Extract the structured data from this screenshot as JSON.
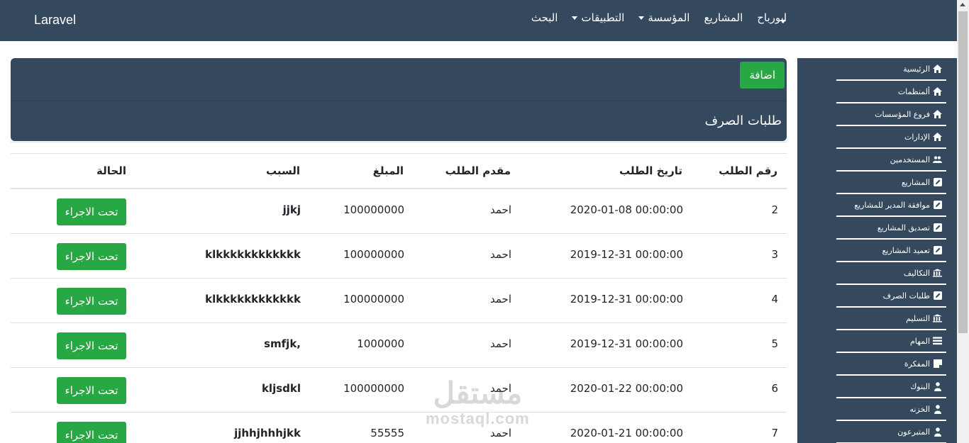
{
  "navbar": {
    "brand": "Laravel",
    "items": [
      {
        "label": "ابورباح",
        "dropdown": false
      },
      {
        "label": "المشاريع",
        "dropdown": false
      },
      {
        "label": "المؤسسة",
        "dropdown": true
      },
      {
        "label": "التطبيقات",
        "dropdown": true
      },
      {
        "label": "البحث",
        "dropdown": false
      }
    ]
  },
  "sidebar": {
    "items": [
      {
        "label": "الرئيسية",
        "icon": "home-icon"
      },
      {
        "label": "ألمنظمات",
        "icon": "home-icon"
      },
      {
        "label": "فروع المؤسسات",
        "icon": "home-icon"
      },
      {
        "label": "الإدارات",
        "icon": "home-icon"
      },
      {
        "label": "المستخدمين",
        "icon": "users-icon"
      },
      {
        "label": "المشاريع",
        "icon": "edit-icon"
      },
      {
        "label": "موافقة المدير للمشاريع",
        "icon": "edit-icon"
      },
      {
        "label": "تصديق المشاريع",
        "icon": "edit-icon"
      },
      {
        "label": "تعميد المشاريع",
        "icon": "edit-icon"
      },
      {
        "label": "التكاليف",
        "icon": "bank-icon"
      },
      {
        "label": "طلبات الصرف",
        "icon": "edit-icon"
      },
      {
        "label": "التسليم",
        "icon": "bank-icon"
      },
      {
        "label": "المهام",
        "icon": "list-icon"
      },
      {
        "label": "المفكرة",
        "icon": "note-icon"
      },
      {
        "label": "البنوك",
        "icon": "user-icon"
      },
      {
        "label": "الخزنه",
        "icon": "user-icon"
      },
      {
        "label": "المتبرعون",
        "icon": "user-icon"
      }
    ]
  },
  "header": {
    "add_label": "اضافة",
    "title": "طلبات الصرف"
  },
  "table": {
    "columns": [
      "رقم الطلب",
      "تاريخ الطلب",
      "مقدم الطلب",
      "المبلغ",
      "السبب",
      "الحالة"
    ],
    "rows": [
      {
        "id": "2",
        "date": "2020-01-08 00:00:00",
        "applicant": "احمد",
        "amount": "100000000",
        "reason": "jjkj",
        "status": "تحت الاجراء"
      },
      {
        "id": "3",
        "date": "2019-12-31 00:00:00",
        "applicant": "احمد",
        "amount": "100000000",
        "reason": "klkkkkkkkkkkkk",
        "status": "تحت الاجراء"
      },
      {
        "id": "4",
        "date": "2019-12-31 00:00:00",
        "applicant": "احمد",
        "amount": "100000000",
        "reason": "klkkkkkkkkkkkk",
        "status": "تحت الاجراء"
      },
      {
        "id": "5",
        "date": "2019-12-31 00:00:00",
        "applicant": "احمد",
        "amount": "1000000",
        "reason": "smfjk,",
        "status": "تحت الاجراء"
      },
      {
        "id": "6",
        "date": "2020-01-22 00:00:00",
        "applicant": "احمد",
        "amount": "100000000",
        "reason": "kljsdkl",
        "status": "تحت الاجراء"
      },
      {
        "id": "7",
        "date": "2020-01-21 00:00:00",
        "applicant": "احمد",
        "amount": "55555",
        "reason": "jjhhjhhhjkk",
        "status": "تحت الاجراء"
      }
    ]
  },
  "watermark": {
    "arabic": "مستقل",
    "latin": "mostaql.com"
  },
  "colors": {
    "navbar": "#34495e",
    "success": "#28a745"
  }
}
